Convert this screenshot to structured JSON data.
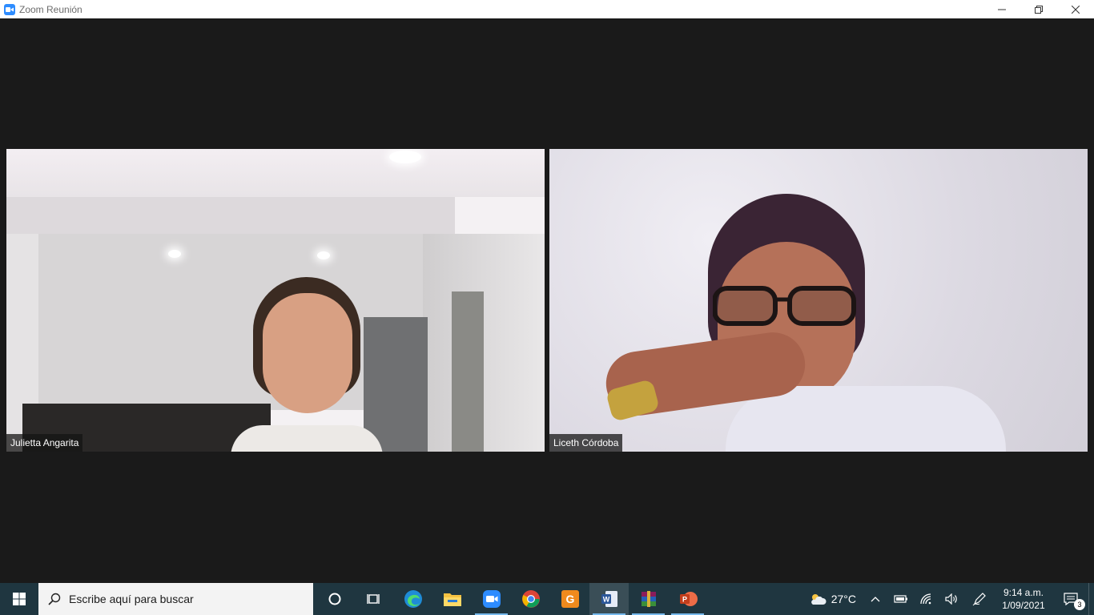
{
  "window": {
    "title": "Zoom Reunión",
    "controls": [
      "minimize",
      "restore",
      "close"
    ]
  },
  "meeting": {
    "participants": [
      {
        "name": "Julietta Angarita"
      },
      {
        "name": "Liceth Córdoba"
      }
    ]
  },
  "taskbar": {
    "search_placeholder": "Escribe aquí para buscar",
    "apps": [
      {
        "icon": "cortana-icon"
      },
      {
        "icon": "task-view-icon"
      },
      {
        "icon": "edge-icon"
      },
      {
        "icon": "file-explorer-icon"
      },
      {
        "icon": "zoom-icon"
      },
      {
        "icon": "chrome-icon"
      },
      {
        "icon": "pdf-app-icon"
      },
      {
        "icon": "word-icon"
      },
      {
        "icon": "winrar-icon"
      },
      {
        "icon": "powerpoint-icon"
      }
    ],
    "tray": {
      "temperature": "27°C",
      "time": "9:14 a.m.",
      "date": "1/09/2021",
      "notification_count": "3"
    }
  },
  "colors": {
    "zoom_blue": "#2d8cff",
    "meeting_bg": "#1a1a1a",
    "taskbar_bg": "#1f3640"
  }
}
